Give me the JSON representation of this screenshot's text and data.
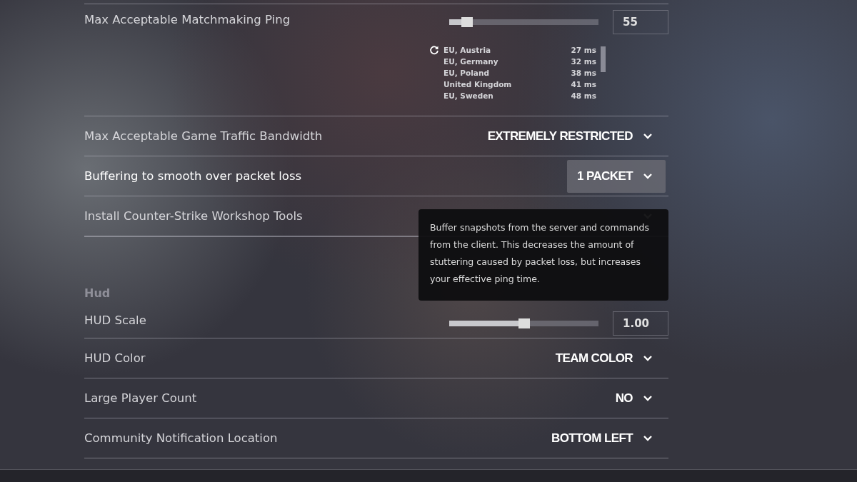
{
  "rows": [
    {
      "kind": "slider",
      "label": "Max Acceptable Matchmaking Ping",
      "level": 0.12,
      "value": "55",
      "servers": [
        {
          "name": "EU, Austria",
          "ping": "27 ms"
        },
        {
          "name": "EU, Germany",
          "ping": "32 ms"
        },
        {
          "name": "EU, Poland",
          "ping": "38 ms"
        },
        {
          "name": "United Kingdom",
          "ping": "41 ms"
        },
        {
          "name": "EU, Sweden",
          "ping": "48 ms"
        }
      ]
    },
    {
      "kind": "dropdown",
      "label": "Max Acceptable Game Traffic Bandwidth",
      "value": "EXTREMELY RESTRICTED",
      "highlighted": false
    },
    {
      "kind": "dropdown",
      "label": "Buffering to smooth over packet loss",
      "value": "1 PACKET",
      "highlighted": true
    },
    {
      "kind": "dropdown",
      "label": "Install Counter-Strike Workshop Tools",
      "highlighted": false
    },
    {
      "kind": "section",
      "label": "Hud"
    },
    {
      "kind": "slider",
      "label": "HUD Scale",
      "level": 0.5,
      "value": "1.00"
    },
    {
      "kind": "dropdown",
      "label": "HUD Color",
      "value": "TEAM COLOR",
      "highlighted": false
    },
    {
      "kind": "dropdown",
      "label": "Large Player Count",
      "value": "NO",
      "highlighted": false
    },
    {
      "kind": "dropdown",
      "label": "Community Notification Location",
      "value": "BOTTOM LEFT",
      "highlighted": false
    }
  ],
  "tooltip": {
    "text": "Buffer snapshots from the server and commands from the client. This decreases the amount of stuttering caused by packet loss, but increases your effective ping time."
  }
}
